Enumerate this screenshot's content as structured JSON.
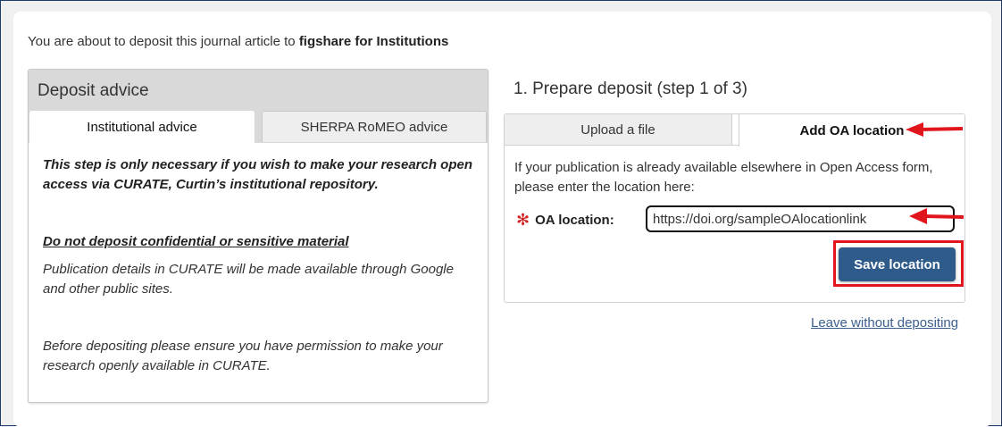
{
  "intro": {
    "prefix": "You are about to deposit this journal article to ",
    "target": "figshare for Institutions"
  },
  "advice": {
    "title": "Deposit advice",
    "tabs": [
      {
        "label": "Institutional advice",
        "active": true
      },
      {
        "label": "SHERPA RoMEO advice",
        "active": false
      }
    ],
    "paragraphs": {
      "p1": "This step is only necessary if you wish to make your research open access via CURATE, Curtin’s institutional repository.",
      "warning": "Do not deposit confidential or sensitive material",
      "p2": "Publication details in CURATE will be made available through Google and other public sites.",
      "p3": "Before depositing please ensure you have permission to make your research openly available in CURATE."
    }
  },
  "deposit": {
    "step_title": "1. Prepare deposit (step 1 of 3)",
    "tabs": [
      {
        "label": "Upload a file",
        "active": false
      },
      {
        "label": "Add OA location",
        "active": true
      }
    ],
    "help_text": "If your publication is already available elsewhere in Open Access form, please enter the location here:",
    "required_marker": "✻",
    "field_label": "OA location:",
    "field_value": "https://doi.org/sampleOAlocationlink",
    "save_label": "Save location",
    "leave_label": "Leave without depositing"
  },
  "colors": {
    "annotation_red": "#e0161c",
    "button_blue": "#2f5b8b",
    "link_blue": "#3a5f8f"
  },
  "icons": [
    "arrow-left-icon",
    "required-asterisk-icon"
  ]
}
